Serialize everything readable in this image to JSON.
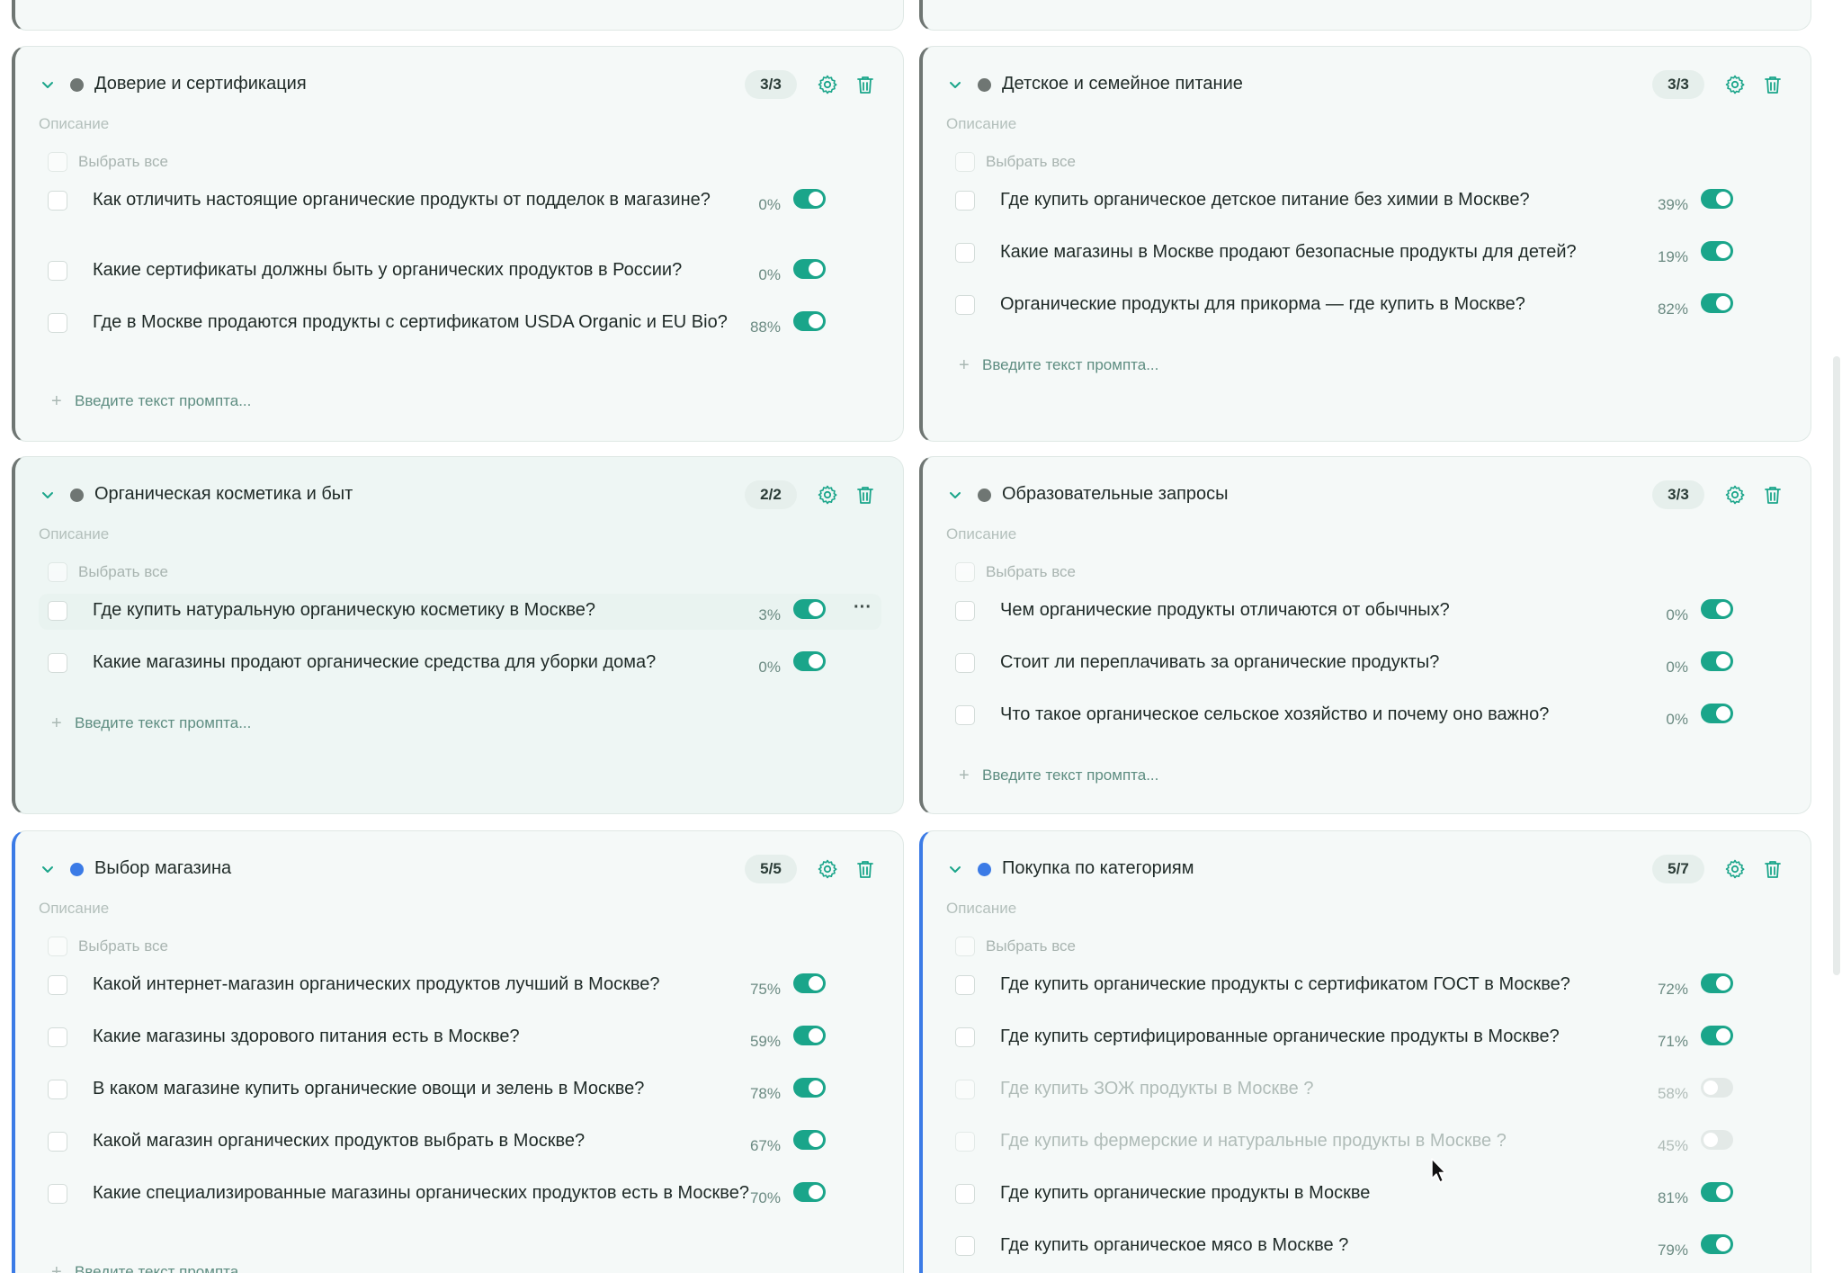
{
  "colors": {
    "accent": "#1aa58a",
    "gray_dot": "#6f7673",
    "blue_dot": "#3b7be6"
  },
  "common": {
    "description_label": "Описание",
    "select_all_label": "Выбрать все",
    "add_prompt_label": "Введите текст промпта..."
  },
  "groups": [
    {
      "title": "Доверие и сертификация",
      "count": "3/3",
      "dot": "gray",
      "prompts": [
        {
          "text": "Как отличить настоящие органические продукты от подделок в магазине?",
          "pct": "0%",
          "enabled": true
        },
        {
          "text": "Какие сертификаты должны быть у органических продуктов в России?",
          "pct": "0%",
          "enabled": true
        },
        {
          "text": "Где в Москве продаются продукты с сертификатом USDA Organic и EU Bio?",
          "pct": "88%",
          "enabled": true
        }
      ]
    },
    {
      "title": "Детское и семейное питание",
      "count": "3/3",
      "dot": "gray",
      "prompts": [
        {
          "text": "Где купить органическое детское питание без химии в Москве?",
          "pct": "39%",
          "enabled": true
        },
        {
          "text": "Какие магазины в Москве продают безопасные продукты для детей?",
          "pct": "19%",
          "enabled": true
        },
        {
          "text": "Органические продукты для прикорма — где купить в Москве?",
          "pct": "82%",
          "enabled": true
        }
      ]
    },
    {
      "title": "Органическая косметика и быт",
      "count": "2/2",
      "dot": "gray",
      "prompts": [
        {
          "text": "Где купить натуральную органическую косметику в Москве?",
          "pct": "3%",
          "enabled": true
        },
        {
          "text": "Какие магазины продают органические средства для уборки дома?",
          "pct": "0%",
          "enabled": true
        }
      ]
    },
    {
      "title": "Образовательные запросы",
      "count": "3/3",
      "dot": "gray",
      "prompts": [
        {
          "text": "Чем органические продукты отличаются от обычных?",
          "pct": "0%",
          "enabled": true
        },
        {
          "text": "Стоит ли переплачивать за органические продукты?",
          "pct": "0%",
          "enabled": true
        },
        {
          "text": "Что такое органическое сельское хозяйство и почему оно важно?",
          "pct": "0%",
          "enabled": true
        }
      ]
    },
    {
      "title": "Выбор магазина",
      "count": "5/5",
      "dot": "blue",
      "prompts": [
        {
          "text": "Какой интернет-магазин органических продуктов лучший в Москве?",
          "pct": "75%",
          "enabled": true
        },
        {
          "text": "Какие магазины здорового питания есть в Москве?",
          "pct": "59%",
          "enabled": true
        },
        {
          "text": "В каком магазине купить органические овощи и зелень в Москве?",
          "pct": "78%",
          "enabled": true
        },
        {
          "text": "Какой магазин органических продуктов выбрать в Москве?",
          "pct": "67%",
          "enabled": true
        },
        {
          "text": "Какие специализированные магазины органических продуктов есть в Москве?",
          "pct": "70%",
          "enabled": true
        }
      ]
    },
    {
      "title": "Покупка по категориям",
      "count": "5/7",
      "dot": "blue",
      "prompts": [
        {
          "text": "Где купить органические продукты с сертификатом ГОСТ в Москве?",
          "pct": "72%",
          "enabled": true
        },
        {
          "text": "Где купить сертифицированные органические продукты в Москве?",
          "pct": "71%",
          "enabled": true
        },
        {
          "text": "Где купить ЗОЖ продукты в Москве ?",
          "pct": "58%",
          "enabled": false
        },
        {
          "text": "Где купить фермерские и натуральные продукты в Москве ?",
          "pct": "45%",
          "enabled": false
        },
        {
          "text": "Где купить органические продукты в Москве",
          "pct": "81%",
          "enabled": true
        },
        {
          "text": "Где купить органическое мясо в Москве ?",
          "pct": "79%",
          "enabled": true
        }
      ]
    }
  ]
}
